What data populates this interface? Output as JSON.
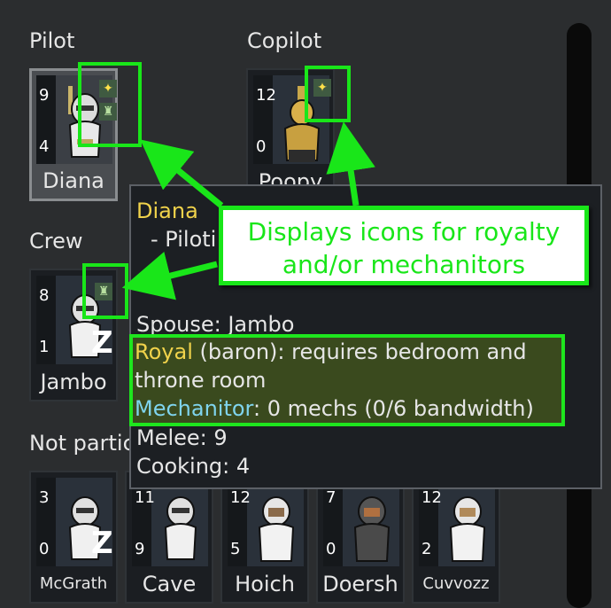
{
  "sections": {
    "pilot": "Pilot",
    "copilot": "Copilot",
    "crew": "Crew",
    "not_participating": "Not partic"
  },
  "cards": {
    "diana": {
      "name": "Diana",
      "stat_top": "9",
      "stat_bottom": "4"
    },
    "poopy": {
      "name": "Poopy",
      "stat_top": "12",
      "stat_bottom": "0"
    },
    "jambo": {
      "name": "Jambo",
      "stat_top": "8",
      "stat_bottom": "1",
      "status": "Z"
    },
    "mcgrath": {
      "name": "McGrath",
      "stat_top": "3",
      "stat_bottom": "0",
      "status": "Z"
    },
    "cave": {
      "name": "Cave",
      "stat_top": "11",
      "stat_bottom": "9"
    },
    "hoich": {
      "name": "Hoich",
      "stat_top": "12",
      "stat_bottom": "5"
    },
    "doersh": {
      "name": "Doersh",
      "stat_top": "7",
      "stat_bottom": "0"
    },
    "cuvvozz": {
      "name": "Cuvvozz",
      "stat_top": "12",
      "stat_bottom": "2"
    }
  },
  "tooltip": {
    "name": "Diana",
    "role": "- Piloti",
    "spouse": "Spouse: Jambo",
    "royal_label": "Royal",
    "royal_text": " (baron): requires bedroom and",
    "royal_text2": "throne room",
    "mechanitor_label": "Mechanitor",
    "mechanitor_text": ": 0 mechs (0/6 bandwidth)",
    "melee": "Melee: 9",
    "cooking": "Cooking: 4"
  },
  "callout": {
    "line1": "Displays icons for royalty",
    "line2": "and/or mechanitors"
  },
  "colors": {
    "highlight": "#19e619",
    "royal_gold": "#f0d24b",
    "mechanitor_cyan": "#7fd4ee"
  }
}
